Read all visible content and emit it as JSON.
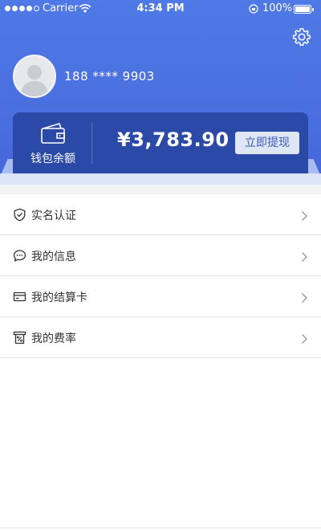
{
  "status_bar": {
    "carrier": "Carrier",
    "time": "4:34 PM",
    "battery": "100%"
  },
  "header": {
    "settings_icon": "gear-icon",
    "phone": "188 **** 9903"
  },
  "wallet": {
    "label": "钱包余额",
    "balance": "¥3,783.90",
    "withdraw": "立即提现"
  },
  "menu": {
    "items": [
      {
        "icon": "shield-check-icon",
        "label": "实名认证"
      },
      {
        "icon": "chat-bubble-icon",
        "label": "我的信息"
      },
      {
        "icon": "card-icon",
        "label": "我的结算卡"
      },
      {
        "icon": "percent-receipt-icon",
        "label": "我的费率"
      }
    ]
  },
  "colors": {
    "header": "#4a6fe0",
    "card": "#2b49a6",
    "button_bg": "#dfe6f6",
    "button_text": "#3d5bb8"
  }
}
